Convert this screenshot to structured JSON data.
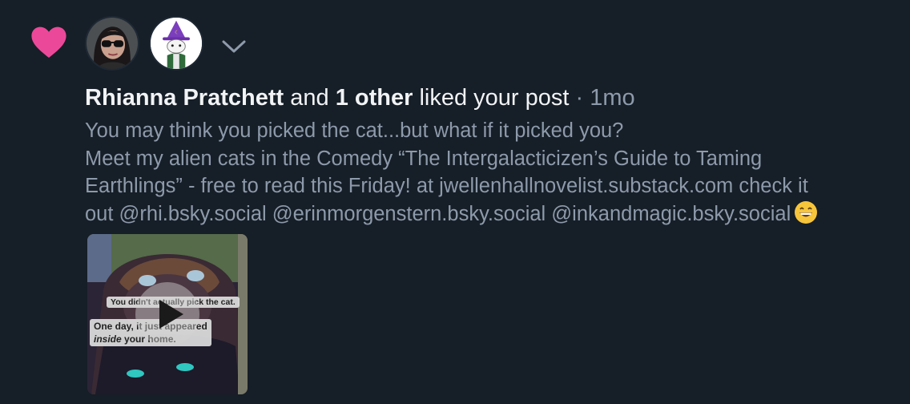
{
  "notification": {
    "type_icon": "heart-icon",
    "accent_color": "#ec4899",
    "avatars": [
      "avatar-woman-sunglasses",
      "avatar-cat-wizard"
    ],
    "expand_icon": "chevron-down-icon",
    "actor_name": "Rhianna Pratchett",
    "connector": "and",
    "others_text": "1 other",
    "action_text": "liked your post",
    "separator": "·",
    "timestamp": "1mo"
  },
  "post": {
    "lines": [
      "You may think you picked the cat...but what if it picked you?",
      "Meet my alien cats in the Comedy “The Intergalacticizen’s Guide to Taming",
      "Earthlings” - free to read this Friday! at jwellenhallnovelist.substack.com check it",
      "out @rhi.bsky.social @erinmorgenstern.bsky.social @inkandmagic.bsky.social"
    ],
    "emoji": "grinning-face-emoji",
    "video": {
      "caption_1": "You didn't actually pick the cat.",
      "caption_2a": "One day, it just appeared",
      "caption_2b_italic": "inside",
      "caption_2c": "your home.",
      "play_icon": "play-icon"
    }
  }
}
